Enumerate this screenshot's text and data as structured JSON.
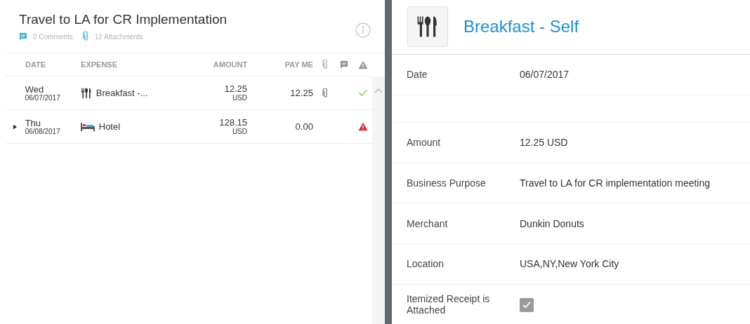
{
  "report": {
    "title": "Travel to LA for CR Implementation",
    "comments": "0 Comments",
    "attachments": "12 Attachments"
  },
  "table": {
    "columns": [
      {
        "kind": "text",
        "label": "DATE"
      },
      {
        "kind": "text",
        "label": "EXPENSE"
      },
      {
        "kind": "text",
        "label": "AMOUNT"
      },
      {
        "kind": "text",
        "label": "PAY ME"
      },
      {
        "kind": "attach"
      },
      {
        "kind": "comment"
      },
      {
        "kind": "alert"
      }
    ],
    "rows": [
      {
        "day": "Wed",
        "date": "06/07/2017",
        "expense_icon": {
          "kind": "meal"
        },
        "expense": "Breakfast -...",
        "amount": "12.25",
        "currency": "USD",
        "pay_me": "12.25",
        "has_attachment": true,
        "expandable": false,
        "status_icon": {
          "kind": "ok"
        }
      },
      {
        "day": "Thu",
        "date": "06/08/2017",
        "expense_icon": {
          "kind": "hotel"
        },
        "expense": "Hotel",
        "amount": "128.15",
        "currency": "USD",
        "pay_me": "0.00",
        "has_attachment": false,
        "expandable": true,
        "status_icon": {
          "kind": "warning"
        }
      }
    ]
  },
  "detail": {
    "icon": {
      "kind": "meal"
    },
    "title": "Breakfast - Self",
    "fields": [
      {
        "kind": "text",
        "label": "Date",
        "value": "06/07/2017"
      },
      {
        "kind": "spacer"
      },
      {
        "kind": "text",
        "label": "Amount",
        "value": "12.25  USD"
      },
      {
        "kind": "text",
        "label": "Business Purpose",
        "value": "Travel to LA for CR implementation meeting"
      },
      {
        "kind": "text",
        "label": "Merchant",
        "value": "Dunkin Donuts"
      },
      {
        "kind": "text",
        "label": "Location",
        "value": "USA,NY,New York City"
      },
      {
        "kind": "checkbox",
        "label": "Itemized Receipt is Attached",
        "checked": true
      }
    ]
  }
}
